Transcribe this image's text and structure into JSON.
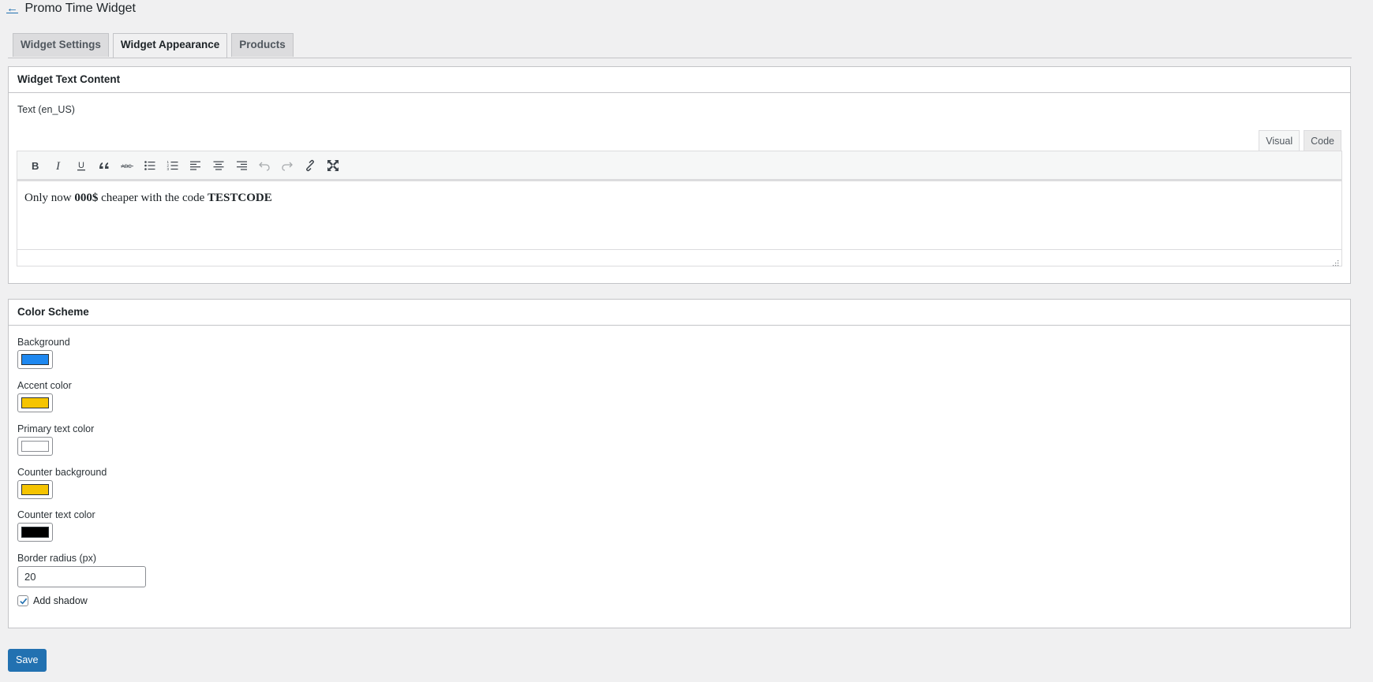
{
  "header": {
    "back_glyph": "←",
    "title": "Promo Time Widget"
  },
  "tabs": [
    {
      "label": "Widget Settings",
      "active": false
    },
    {
      "label": "Widget Appearance",
      "active": true
    },
    {
      "label": "Products",
      "active": false
    }
  ],
  "text_section": {
    "title": "Widget Text Content",
    "field_label": "Text (en_US)",
    "editor_tabs": {
      "visual": "Visual",
      "code": "Code"
    },
    "toolbar_icons": [
      "bold-icon",
      "italic-icon",
      "underline-icon",
      "blockquote-icon",
      "strikethrough-icon",
      "bullet-list-icon",
      "numbered-list-icon",
      "align-left-icon",
      "align-center-icon",
      "align-right-icon",
      "undo-icon",
      "redo-icon",
      "link-icon",
      "fullscreen-icon"
    ],
    "content": {
      "prefix": "Only now ",
      "bold_amount": "000$",
      "middle": " cheaper with the code ",
      "bold_code": "TESTCODE"
    }
  },
  "color_section": {
    "title": "Color Scheme",
    "colors": {
      "background": {
        "label": "Background",
        "value": "#1e88f0"
      },
      "accent": {
        "label": "Accent color",
        "value": "#f5c400"
      },
      "primary_text": {
        "label": "Primary text color",
        "value": "#ffffff"
      },
      "counter_background": {
        "label": "Counter background",
        "value": "#f5c400"
      },
      "counter_text": {
        "label": "Counter text color",
        "value": "#000000"
      }
    },
    "border_radius": {
      "label": "Border radius (px)",
      "value": "20"
    },
    "shadow": {
      "label": "Add shadow",
      "checked": true
    }
  },
  "save_label": "Save"
}
